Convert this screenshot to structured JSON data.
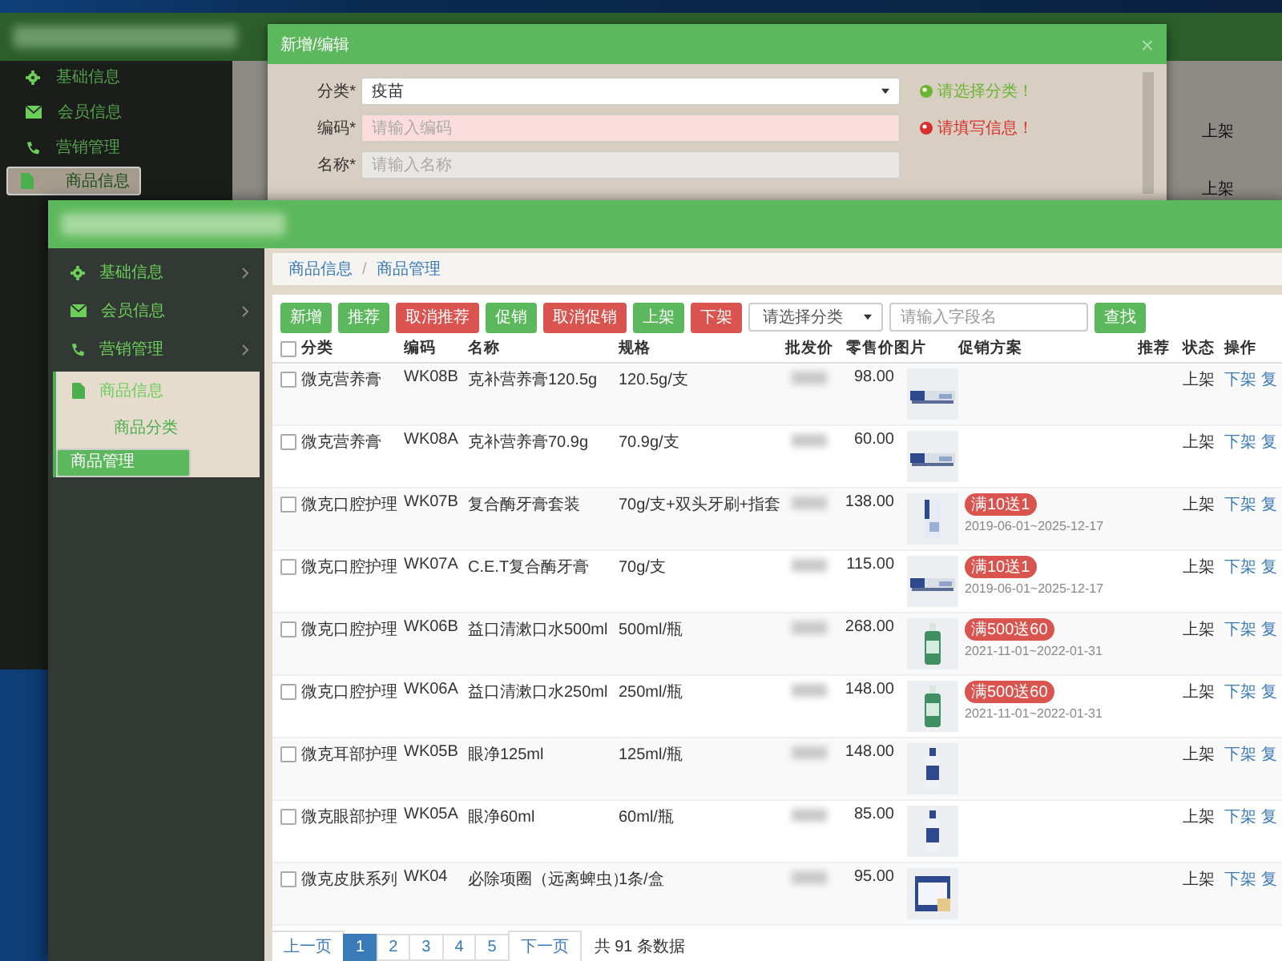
{
  "back_window": {
    "sidebar": {
      "items": [
        {
          "label": "基础信息",
          "selected": false
        },
        {
          "label": "会员信息",
          "selected": false
        },
        {
          "label": "营销管理",
          "selected": false
        },
        {
          "label": "商品信息",
          "selected": true
        }
      ]
    },
    "statuses": [
      "上架",
      "上架"
    ],
    "dialog": {
      "title": "新增/编辑",
      "close": "×",
      "fields": [
        {
          "label": "分类*",
          "kind": "select",
          "value": "疫苗",
          "validated": true,
          "valid": true,
          "message": "请选择分类！"
        },
        {
          "label": "编码*",
          "kind": "input",
          "placeholder": "请输入编码",
          "validated": true,
          "valid": false,
          "message": "请填写信息！"
        },
        {
          "label": "名称*",
          "kind": "input",
          "placeholder": "请输入名称",
          "validated": false
        }
      ]
    }
  },
  "front_window": {
    "sidebar": {
      "items": [
        {
          "label": "基础信息",
          "expanded": false
        },
        {
          "label": "会员信息",
          "expanded": false
        },
        {
          "label": "营销管理",
          "expanded": false
        },
        {
          "label": "商品信息",
          "expanded": true,
          "children": [
            {
              "label": "商品分类",
              "selected": false
            },
            {
              "label": "商品管理",
              "selected": true
            }
          ]
        }
      ]
    },
    "breadcrumb": [
      "商品信息",
      "商品管理"
    ],
    "breadcrumb_separator": "/",
    "toolbar": [
      {
        "label": "新增",
        "kind": "success"
      },
      {
        "label": "推荐",
        "kind": "success"
      },
      {
        "label": "取消推荐",
        "kind": "danger"
      },
      {
        "label": "促销",
        "kind": "success"
      },
      {
        "label": "取消促销",
        "kind": "danger"
      },
      {
        "label": "上架",
        "kind": "success"
      },
      {
        "label": "下架",
        "kind": "danger"
      }
    ],
    "category_select": {
      "placeholder": "请选择分类"
    },
    "search": {
      "placeholder": "请输入字段名",
      "button": "查找"
    },
    "table": {
      "all_checked": false,
      "columns": [
        "分类",
        "编码",
        "名称",
        "规格",
        "批发价",
        "零售价",
        "图片",
        "促销方案",
        "推荐",
        "状态",
        "操作"
      ],
      "rows": [
        {
          "checked": false,
          "category": "微克营养膏",
          "code": "WK08B",
          "name": "克补营养膏120.5g",
          "spec": "120.5g/支",
          "retail": "98.00",
          "status": "上架",
          "actions": [
            "下架",
            "复"
          ]
        },
        {
          "checked": false,
          "category": "微克营养膏",
          "code": "WK08A",
          "name": "克补营养膏70.9g",
          "spec": "70.9g/支",
          "retail": "60.00",
          "status": "上架",
          "actions": [
            "下架",
            "复"
          ]
        },
        {
          "checked": false,
          "category": "微克口腔护理",
          "code": "WK07B",
          "name": "复合酶牙膏套装",
          "spec": "70g/支+双头牙刷+指套",
          "retail": "138.00",
          "promotion": {
            "tag": "满10送1",
            "period": "2019-06-01~2025-12-17"
          },
          "status": "上架",
          "actions": [
            "下架",
            "复"
          ]
        },
        {
          "checked": false,
          "category": "微克口腔护理",
          "code": "WK07A",
          "name": "C.E.T复合酶牙膏",
          "spec": "70g/支",
          "retail": "115.00",
          "promotion": {
            "tag": "满10送1",
            "period": "2019-06-01~2025-12-17"
          },
          "status": "上架",
          "actions": [
            "下架",
            "复"
          ]
        },
        {
          "checked": false,
          "category": "微克口腔护理",
          "code": "WK06B",
          "name": "益口清漱口水500ml",
          "spec": "500ml/瓶",
          "retail": "268.00",
          "promotion": {
            "tag": "满500送60",
            "period": "2021-11-01~2022-01-31"
          },
          "status": "上架",
          "actions": [
            "下架",
            "复"
          ]
        },
        {
          "checked": false,
          "category": "微克口腔护理",
          "code": "WK06A",
          "name": "益口清漱口水250ml",
          "spec": "250ml/瓶",
          "retail": "148.00",
          "promotion": {
            "tag": "满500送60",
            "period": "2021-11-01~2022-01-31"
          },
          "status": "上架",
          "actions": [
            "下架",
            "复"
          ]
        },
        {
          "checked": false,
          "category": "微克耳部护理",
          "code": "WK05B",
          "name": "眼净125ml",
          "spec": "125ml/瓶",
          "retail": "148.00",
          "status": "上架",
          "actions": [
            "下架",
            "复"
          ]
        },
        {
          "checked": false,
          "category": "微克眼部护理",
          "code": "WK05A",
          "name": "眼净60ml",
          "spec": "60ml/瓶",
          "retail": "85.00",
          "status": "上架",
          "actions": [
            "下架",
            "复"
          ]
        },
        {
          "checked": false,
          "category": "微克皮肤系列",
          "code": "WK04",
          "name": "必除项圈（远离蜱虫）",
          "spec": "1条/盒",
          "retail": "95.00",
          "status": "上架",
          "actions": [
            "下架",
            "复"
          ]
        }
      ]
    },
    "pagination": {
      "prev": "上一页",
      "pages": [
        {
          "label": "1",
          "selected": true
        },
        {
          "label": "2",
          "selected": false
        },
        {
          "label": "3",
          "selected": false
        },
        {
          "label": "4",
          "selected": false
        },
        {
          "label": "5",
          "selected": false
        }
      ],
      "next": "下一页",
      "total": "共 91 条数据"
    }
  }
}
